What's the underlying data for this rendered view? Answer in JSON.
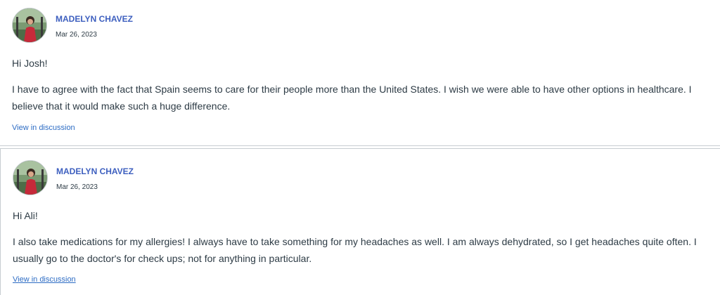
{
  "posts": [
    {
      "author": "MADELYN CHAVEZ",
      "date": "Mar 26, 2023",
      "greeting": "Hi Josh!",
      "body": "I have to agree with the fact that Spain seems to care for their people more than the United States. I wish we were able to have other options in healthcare. I believe that it would make such a huge difference.",
      "link": "View in discussion"
    },
    {
      "author": "MADELYN CHAVEZ",
      "date": "Mar 26, 2023",
      "greeting": "Hi Ali!",
      "body": "I also take medications for my allergies! I always have to take something for my headaches as well. I am always dehydrated, so I get headaches quite often. I usually go to the doctor's for check ups; not for anything in particular.",
      "link": "View in discussion"
    }
  ],
  "colors": {
    "author": "#3d5fbf",
    "text": "#2d3b45",
    "link": "#2d6cc4",
    "divider": "#c7cdd1"
  },
  "icons": {
    "avatar": "avatar-photo"
  }
}
